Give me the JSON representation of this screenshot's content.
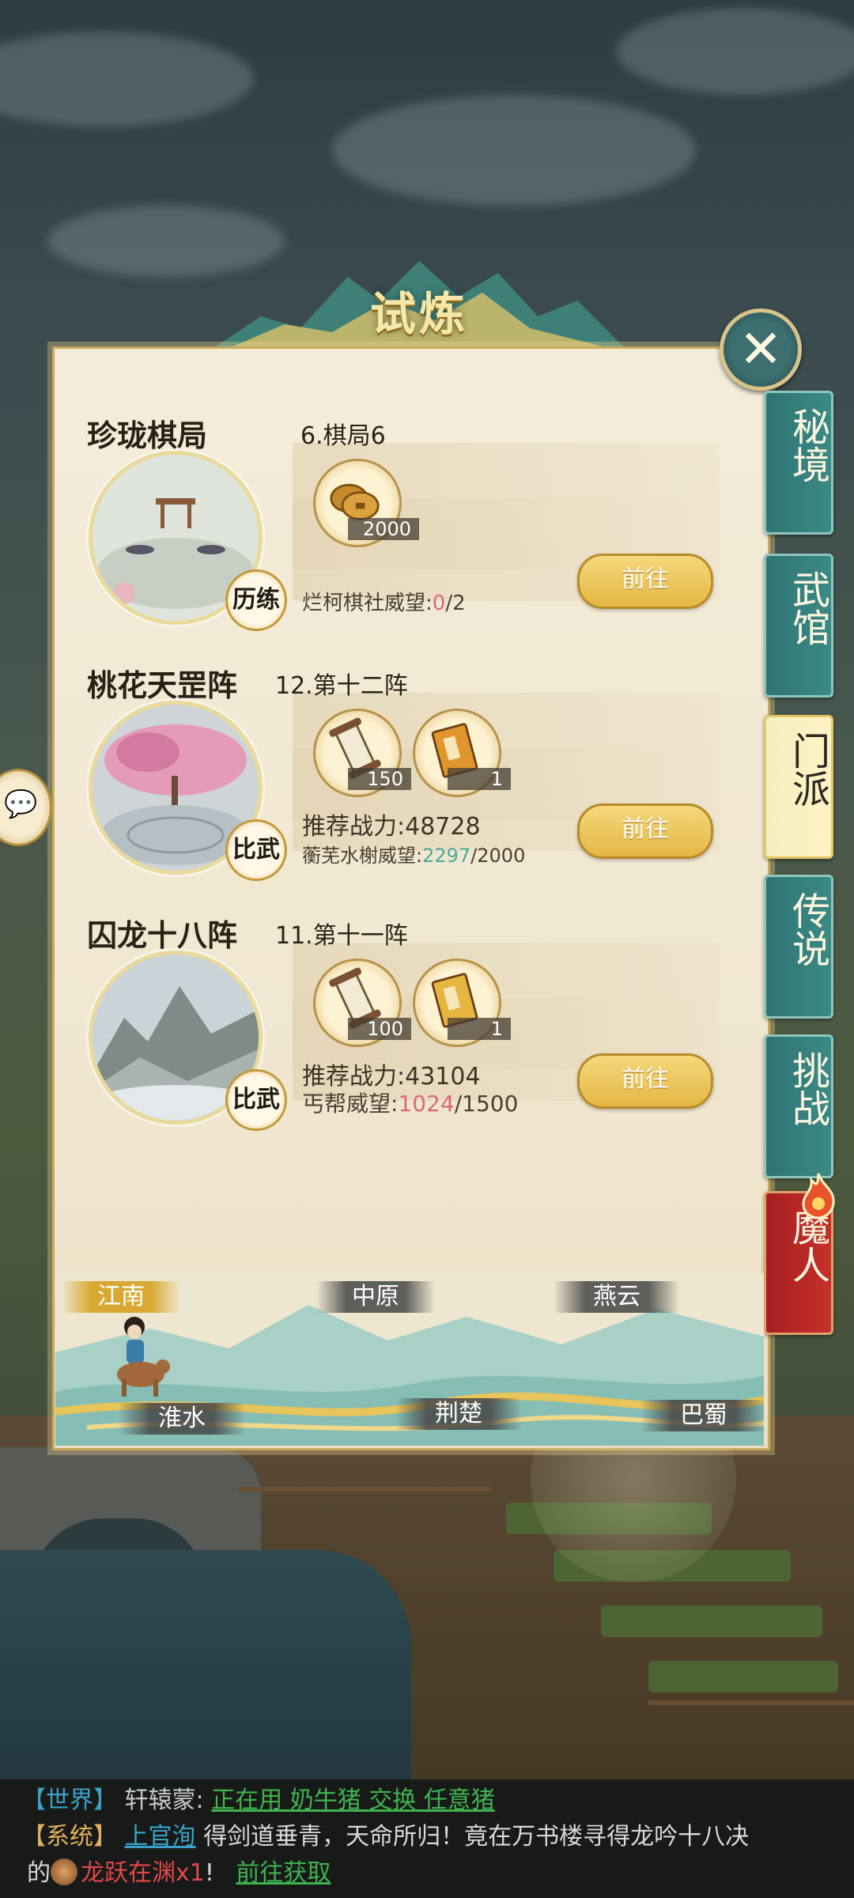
{
  "title": "试炼",
  "close_icon": "close-icon",
  "side_tabs": [
    {
      "label": "秘境",
      "state": "normal"
    },
    {
      "label": "武馆",
      "state": "normal"
    },
    {
      "label": "门派",
      "state": "active"
    },
    {
      "label": "传说",
      "state": "normal"
    },
    {
      "label": "挑战",
      "state": "normal"
    },
    {
      "label": "魔人",
      "state": "special"
    }
  ],
  "trials": [
    {
      "name": "珍珑棋局",
      "stage": "6.棋局6",
      "badge": "历练",
      "rewards": [
        {
          "icon": "copper-coins-icon",
          "count": "2000"
        }
      ],
      "info1_label": "",
      "info1_value": "",
      "rep_label": "烂柯棋社威望:",
      "rep_current": "0",
      "rep_max": "/2",
      "button": "前往"
    },
    {
      "name": "桃花天罡阵",
      "stage": "12.第十二阵",
      "badge": "比武",
      "rewards": [
        {
          "icon": "scroll-icon",
          "count": "150"
        },
        {
          "icon": "book-icon",
          "count": "1"
        }
      ],
      "info1_label": "推荐战力:",
      "info1_value": "48728",
      "rep_label": "蘅芜水榭威望:",
      "rep_current": "2297",
      "rep_max": "/2000",
      "button": "前往"
    },
    {
      "name": "囚龙十八阵",
      "stage": "11.第十一阵",
      "badge": "比武",
      "rewards": [
        {
          "icon": "scroll-icon",
          "count": "100"
        },
        {
          "icon": "book-icon",
          "count": "1"
        }
      ],
      "info1_label": "推荐战力:",
      "info1_value": "43104",
      "rep_label": "丐帮威望:",
      "rep_current": "1024",
      "rep_max": "/1500",
      "button": "前往"
    }
  ],
  "map_regions": [
    {
      "label": "江南",
      "active": true
    },
    {
      "label": "中原",
      "active": false
    },
    {
      "label": "燕云",
      "active": false
    },
    {
      "label": "淮水",
      "active": false
    },
    {
      "label": "荆楚",
      "active": false
    },
    {
      "label": "巴蜀",
      "active": false
    }
  ],
  "chat": {
    "line1": {
      "tag": "【世界】",
      "name": "轩辕蒙:",
      "link": "正在用 奶牛猪 交换 任意猪"
    },
    "line2": {
      "tag": "【系统】",
      "name_link": "上官洵",
      "text": "得剑道垂青，天命所归！竟在万书楼寻得龙吟十八决"
    },
    "line3": {
      "prefix": "的",
      "item": "龙跃在渊x1",
      "suffix": "!",
      "link": "前往获取"
    }
  },
  "colors": {
    "tab_teal": "#2f7474",
    "tab_active": "#fdf3c6",
    "tab_red": "#c5312a",
    "button_gold": "#e4b744",
    "chat_world": "#3aa2c9",
    "chat_system": "#e3b05a",
    "chat_link": "#3fb24f",
    "rep_pink": "#d86a7a",
    "rep_green": "#4fa89a"
  }
}
